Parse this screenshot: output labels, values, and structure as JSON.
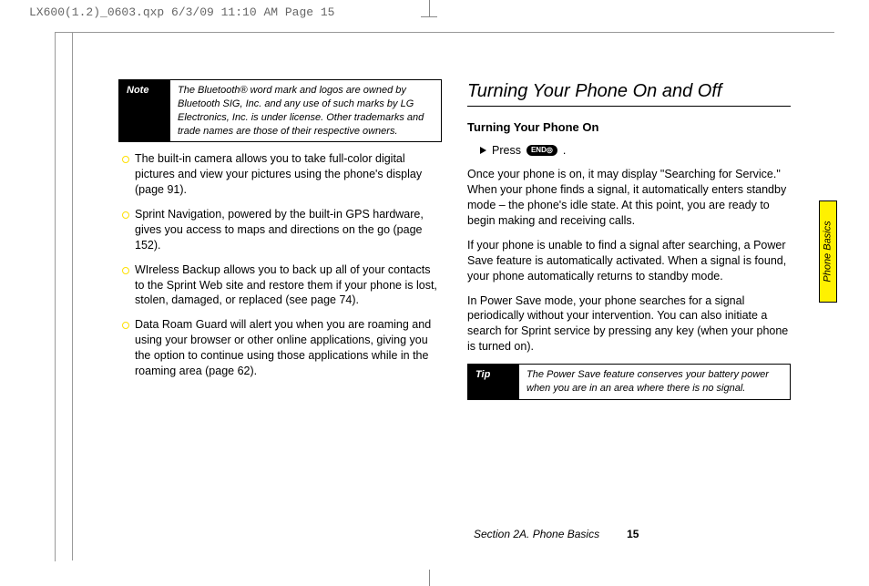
{
  "header": {
    "preflight": "LX600(1.2)_0603.qxp  6/3/09  11:10 AM  Page 15"
  },
  "leftCol": {
    "noteLabel": "Note",
    "noteText": "The Bluetooth® word mark and logos are owned by Bluetooth SIG, Inc. and any use of such marks by LG Electronics, Inc. is under license. Other trademarks and trade names are those of their respective owners.",
    "bullets": [
      "The built-in camera allows you to take full-color digital pictures and view your pictures using the phone's display (page 91).",
      "Sprint Navigation, powered by the built-in GPS hardware, gives you access to maps and directions on the go (page 152).",
      "WIreless Backup allows you to back up all of your contacts to the Sprint Web site and restore them if your phone is lost, stolen, damaged, or replaced (see page 74).",
      "Data Roam Guard will alert you when you are roaming and using your browser or other online applications, giving you the option to continue using those applications while in the roaming area (page 62)."
    ]
  },
  "rightCol": {
    "heading": "Turning Your Phone On and Off",
    "subHeading": "Turning Your Phone On",
    "stepPrefix": "Press",
    "stepButton": "END◎",
    "stepSuffix": ".",
    "paras": [
      "Once your phone is on, it may display \"Searching for Service.\" When your phone finds a signal, it automatically enters standby mode – the phone's idle state. At this point, you are ready to begin making and receiving calls.",
      "If your phone is unable to find a signal after searching, a Power Save feature is automatically activated. When a signal is found, your phone automatically returns to standby mode.",
      "In Power Save mode, your phone searches for a signal periodically without your intervention. You can also initiate a search for Sprint service by pressing any key (when your phone is turned on)."
    ],
    "tipLabel": "Tip",
    "tipText": "The Power Save feature conserves your battery power when you are in an area where there is no signal."
  },
  "sideTab": "Phone Basics",
  "footer": {
    "section": "Section 2A. Phone Basics",
    "page": "15"
  }
}
